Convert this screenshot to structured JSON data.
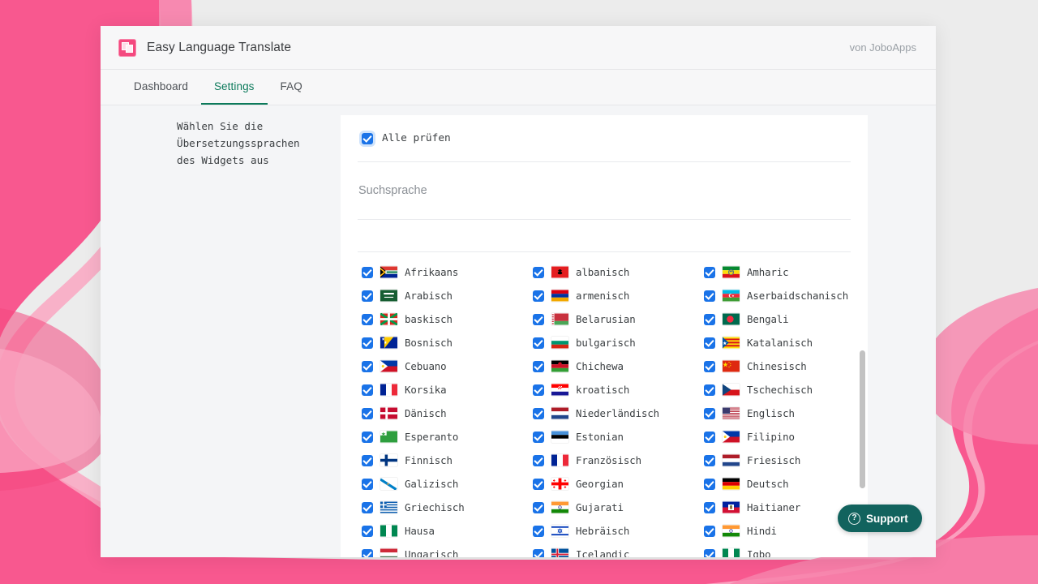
{
  "theme": {
    "pink_dark": "#f8588f",
    "pink_mid": "#f783ab",
    "pink_light": "#f9a8c3",
    "page_bg": "#ececec",
    "accent_green": "#0c7a5b",
    "checkbox_blue": "#1a73e8",
    "support_teal": "#12635e",
    "brand_pink": "#f4497f"
  },
  "header": {
    "app_title": "Easy Language Translate",
    "app_icon": "app-logo-icon",
    "byline": "von JoboApps"
  },
  "tabs": [
    {
      "label": "Dashboard",
      "active": false
    },
    {
      "label": "Settings",
      "active": true
    },
    {
      "label": "FAQ",
      "active": false
    }
  ],
  "sidebar": {
    "instruction": "Wählen Sie die Übersetzungssprachen des Widgets aus"
  },
  "panel": {
    "check_all_label": "Alle prüfen",
    "check_all_checked": true,
    "search_placeholder": "Suchsprache",
    "search_value": ""
  },
  "support": {
    "label": "Support",
    "icon": "question-mark-circle-icon"
  },
  "languages": [
    {
      "name": "Afrikaans",
      "checked": true,
      "flag": "za"
    },
    {
      "name": "albanisch",
      "checked": true,
      "flag": "al"
    },
    {
      "name": "Amharic",
      "checked": true,
      "flag": "et"
    },
    {
      "name": "Arabisch",
      "checked": true,
      "flag": "sa"
    },
    {
      "name": "armenisch",
      "checked": true,
      "flag": "am"
    },
    {
      "name": "Aserbaidschanisch",
      "checked": true,
      "flag": "az"
    },
    {
      "name": "baskisch",
      "checked": true,
      "flag": "eu"
    },
    {
      "name": "Belarusian",
      "checked": true,
      "flag": "by"
    },
    {
      "name": "Bengali",
      "checked": true,
      "flag": "bd"
    },
    {
      "name": "Bosnisch",
      "checked": true,
      "flag": "ba"
    },
    {
      "name": "bulgarisch",
      "checked": true,
      "flag": "bg"
    },
    {
      "name": "Katalanisch",
      "checked": true,
      "flag": "cat"
    },
    {
      "name": "Cebuano",
      "checked": true,
      "flag": "ph"
    },
    {
      "name": "Chichewa",
      "checked": true,
      "flag": "mw"
    },
    {
      "name": "Chinesisch",
      "checked": true,
      "flag": "cn"
    },
    {
      "name": "Korsika",
      "checked": true,
      "flag": "fr"
    },
    {
      "name": "kroatisch",
      "checked": true,
      "flag": "hr"
    },
    {
      "name": "Tschechisch",
      "checked": true,
      "flag": "cz"
    },
    {
      "name": "Dänisch",
      "checked": true,
      "flag": "dk"
    },
    {
      "name": "Niederländisch",
      "checked": true,
      "flag": "nl"
    },
    {
      "name": "Englisch",
      "checked": true,
      "flag": "us"
    },
    {
      "name": "Esperanto",
      "checked": true,
      "flag": "eo"
    },
    {
      "name": "Estonian",
      "checked": true,
      "flag": "ee"
    },
    {
      "name": "Filipino",
      "checked": true,
      "flag": "ph"
    },
    {
      "name": "Finnisch",
      "checked": true,
      "flag": "fi"
    },
    {
      "name": "Französisch",
      "checked": true,
      "flag": "fr"
    },
    {
      "name": "Friesisch",
      "checked": true,
      "flag": "nl"
    },
    {
      "name": "Galizisch",
      "checked": true,
      "flag": "gal"
    },
    {
      "name": "Georgian",
      "checked": true,
      "flag": "ge"
    },
    {
      "name": "Deutsch",
      "checked": true,
      "flag": "de"
    },
    {
      "name": "Griechisch",
      "checked": true,
      "flag": "gr"
    },
    {
      "name": "Gujarati",
      "checked": true,
      "flag": "in"
    },
    {
      "name": "Haitianer",
      "checked": true,
      "flag": "ht"
    },
    {
      "name": "Hausa",
      "checked": true,
      "flag": "ng"
    },
    {
      "name": "Hebräisch",
      "checked": true,
      "flag": "il"
    },
    {
      "name": "Hindi",
      "checked": true,
      "flag": "in"
    },
    {
      "name": "Ungarisch",
      "checked": true,
      "flag": "hu"
    },
    {
      "name": "Icelandic",
      "checked": true,
      "flag": "is"
    },
    {
      "name": "Igbo",
      "checked": true,
      "flag": "ng"
    }
  ]
}
